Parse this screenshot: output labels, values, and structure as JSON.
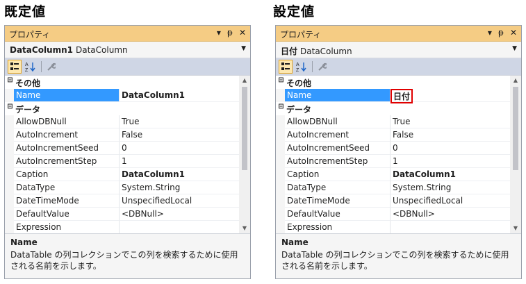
{
  "headings": {
    "left": "既定値",
    "right": "設定値"
  },
  "panels": [
    {
      "title": "プロパティ",
      "titlebar_icons": [
        "▾",
        "ᵽ",
        "✕"
      ],
      "object_name": "DataColumn1",
      "object_type": "DataColumn",
      "categories": [
        {
          "label": "その他",
          "expander": "⊟"
        },
        {
          "label": "データ",
          "expander": "⊟"
        }
      ],
      "other_props": [
        {
          "name": "Name",
          "value": "DataColumn1"
        }
      ],
      "data_props": [
        {
          "name": "AllowDBNull",
          "value": "True"
        },
        {
          "name": "AutoIncrement",
          "value": "False"
        },
        {
          "name": "AutoIncrementSeed",
          "value": "0"
        },
        {
          "name": "AutoIncrementStep",
          "value": "1"
        },
        {
          "name": "Caption",
          "value": "DataColumn1"
        },
        {
          "name": "DataType",
          "value": "System.String"
        },
        {
          "name": "DateTimeMode",
          "value": "UnspecifiedLocal"
        },
        {
          "name": "DefaultValue",
          "value": "<DBNull>"
        },
        {
          "name": "Expression",
          "value": ""
        }
      ],
      "description": {
        "title": "Name",
        "text": "DataTable の列コレクションでこの列を検索するために使用される名前を示します。"
      }
    },
    {
      "title": "プロパティ",
      "titlebar_icons": [
        "▾",
        "ᵽ",
        "✕"
      ],
      "object_name": "日付",
      "object_type": "DataColumn",
      "categories": [
        {
          "label": "その他",
          "expander": "⊟"
        },
        {
          "label": "データ",
          "expander": "⊟"
        }
      ],
      "other_props": [
        {
          "name": "Name",
          "value": "日付"
        }
      ],
      "data_props": [
        {
          "name": "AllowDBNull",
          "value": "True"
        },
        {
          "name": "AutoIncrement",
          "value": "False"
        },
        {
          "name": "AutoIncrementSeed",
          "value": "0"
        },
        {
          "name": "AutoIncrementStep",
          "value": "1"
        },
        {
          "name": "Caption",
          "value": "DataColumn1"
        },
        {
          "name": "DataType",
          "value": "System.String"
        },
        {
          "name": "DateTimeMode",
          "value": "UnspecifiedLocal"
        },
        {
          "name": "DefaultValue",
          "value": "<DBNull>"
        },
        {
          "name": "Expression",
          "value": ""
        }
      ],
      "description": {
        "title": "Name",
        "text": "DataTable の列コレクションでこの列を検索するために使用される名前を示します。"
      }
    }
  ],
  "colors": {
    "titlebar": "#f5cc84",
    "selection": "#3399ff",
    "highlight_box": "#e00000",
    "toolbar": "#cfd6e5"
  }
}
